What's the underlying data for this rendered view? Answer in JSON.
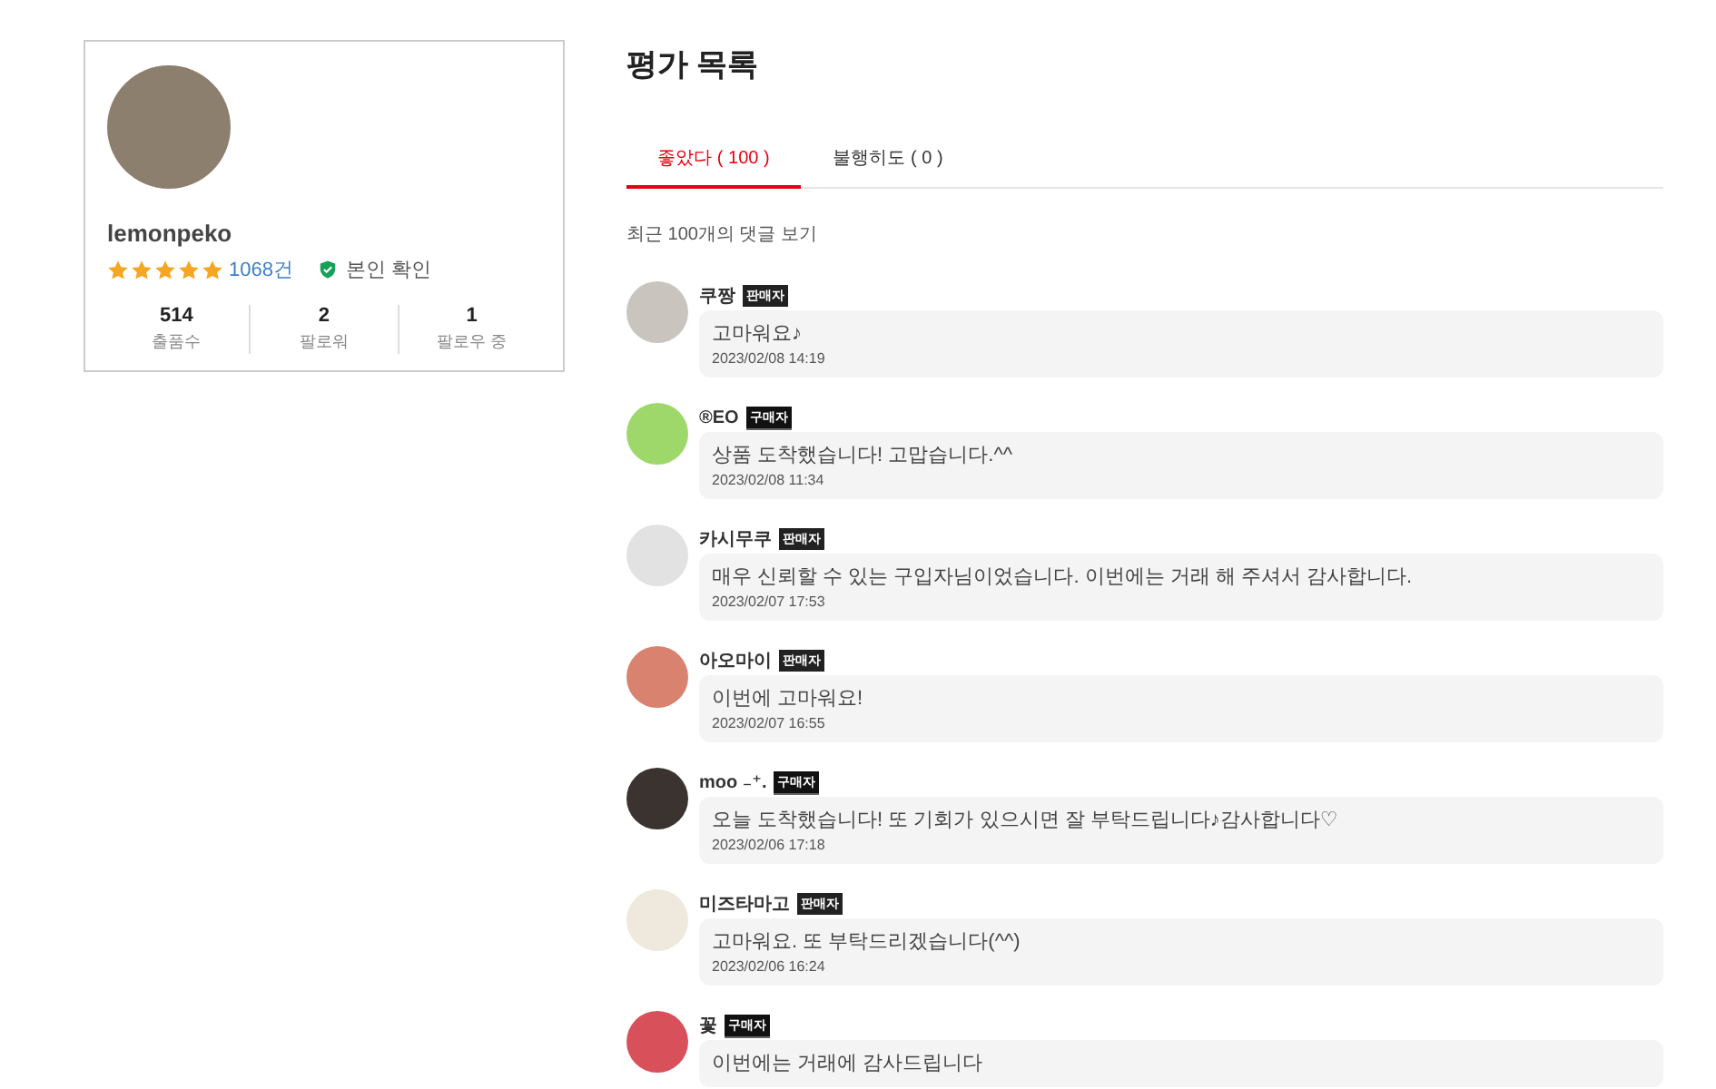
{
  "profile": {
    "username": "lemonpeko",
    "stars": 5,
    "review_count": "1068건",
    "verified": true,
    "verified_label": "본인 확인",
    "stats": [
      {
        "value": "514",
        "label": "출품수"
      },
      {
        "value": "2",
        "label": "팔로워"
      },
      {
        "value": "1",
        "label": "팔로우 중"
      }
    ]
  },
  "title": "평가 목록",
  "tabs": [
    {
      "label": "좋았다 ( 100 )",
      "selected": true
    },
    {
      "label": "불행히도 ( 0 )",
      "selected": false
    }
  ],
  "summary": "최근 100개의 댓글 보기",
  "comments": [
    {
      "name": "쿠짱",
      "kind": "seller",
      "badge": "판매자",
      "text": "고마워요♪",
      "date": "2023/02/08 14:19",
      "color": "#c9c4be"
    },
    {
      "name": "®EO",
      "kind": "buyer",
      "badge": "구매자",
      "text": "상품 도착했습니다! 고맙습니다.^^",
      "date": "2023/02/08 11:34",
      "color": "#9fd86a"
    },
    {
      "name": "카시무쿠",
      "kind": "seller",
      "badge": "판매자",
      "text": "매우 신뢰할 수 있는 구입자님이었습니다. 이번에는 거래 해 주셔서 감사합니다.",
      "date": "2023/02/07 17:53",
      "color": "#e2e2e2"
    },
    {
      "name": "아오마이",
      "kind": "seller",
      "badge": "판매자",
      "text": "이번에 고마워요!",
      "date": "2023/02/07 16:55",
      "color": "#d9826f"
    },
    {
      "name": "moo ₋⁺.",
      "kind": "buyer",
      "badge": "구매자",
      "text": "오늘 도착했습니다! 또 기회가 있으시면 잘 부탁드립니다♪감사합니다♡",
      "date": "2023/02/06 17:18",
      "color": "#3b3330"
    },
    {
      "name": "미즈타마고",
      "kind": "seller",
      "badge": "판매자",
      "text": "고마워요. 또 부탁드리겠습니다(^^)",
      "date": "2023/02/06 16:24",
      "color": "#efe8dc"
    },
    {
      "name": "꽃",
      "kind": "buyer",
      "badge": "구매자",
      "text": "이번에는 거래에 감사드립니다",
      "color": "#d8505a"
    }
  ]
}
